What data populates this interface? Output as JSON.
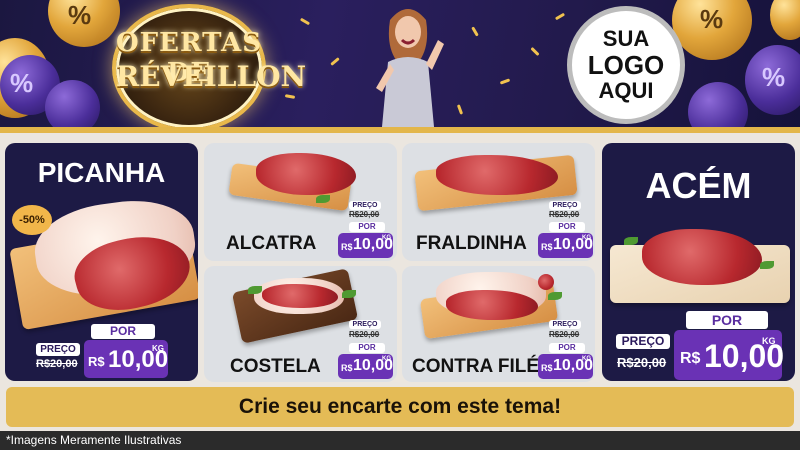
{
  "banner": {
    "seal_line1": "OFERTAS DE",
    "seal_line2": "RÉVEILLON",
    "logo_line1": "SUA",
    "logo_line2": "LOGO",
    "logo_line3": "AQUI",
    "balloon_symbol": "%"
  },
  "products": {
    "picanha": {
      "name": "PICANHA",
      "badge": "-50%",
      "preco_label": "PREÇO",
      "old_price": "R$20,00",
      "por_label": "POR",
      "currency": "R$",
      "price": "10,00",
      "unit": "KG"
    },
    "alcatra": {
      "name": "ALCATRA",
      "preco_label": "PREÇO",
      "old_price": "R$20,00",
      "por_label": "POR",
      "currency": "R$",
      "price": "10,00",
      "unit": "KG"
    },
    "fraldinha": {
      "name": "FRALDINHA",
      "preco_label": "PREÇO",
      "old_price": "R$20,00",
      "por_label": "POR",
      "currency": "R$",
      "price": "10,00",
      "unit": "KG"
    },
    "costela": {
      "name": "COSTELA",
      "preco_label": "PREÇO",
      "old_price": "R$20,00",
      "por_label": "POR",
      "currency": "R$",
      "price": "10,00",
      "unit": "KG"
    },
    "contrafile": {
      "name": "CONTRA FILÉ",
      "preco_label": "PREÇO",
      "old_price": "R$20,00",
      "por_label": "POR",
      "currency": "R$",
      "price": "10,00",
      "unit": "KG"
    },
    "acem": {
      "name": "ACÉM",
      "preco_label": "PREÇO",
      "old_price": "R$20,00",
      "por_label": "POR",
      "currency": "R$",
      "price": "10,00",
      "unit": "KG"
    }
  },
  "footer": {
    "cta": "Crie seu encarte com este tema!",
    "disclaimer": "*Imagens Meramente Ilustrativas"
  },
  "colors": {
    "navy": "#1d1a45",
    "purple": "#6a32b5",
    "gold": "#e4bb56"
  }
}
